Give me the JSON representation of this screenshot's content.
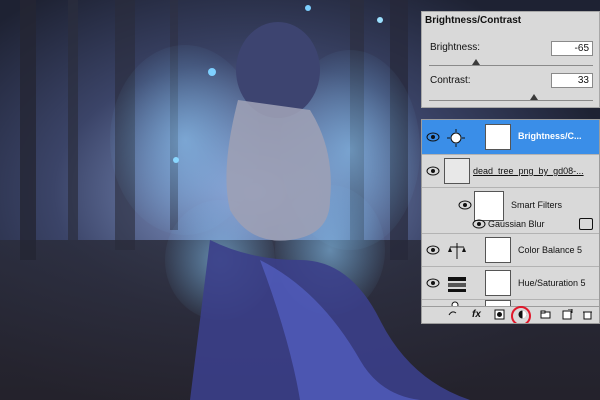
{
  "panel_bc": {
    "title": "Brightness/Contrast",
    "brightness_label": "Brightness:",
    "brightness_value": "-65",
    "contrast_label": "Contrast:",
    "contrast_value": "33"
  },
  "layers": [
    {
      "name": "Brightness/C...",
      "type": "adjustment-brightness",
      "selected": true
    },
    {
      "name": "dead_tree_png_by_gd08-...",
      "type": "smart-object"
    },
    {
      "name": "Smart Filters",
      "type": "smart-filters"
    },
    {
      "name": "Gaussian Blur",
      "type": "filter"
    },
    {
      "name": "Color Balance 5",
      "type": "adjustment-color-balance"
    },
    {
      "name": "Hue/Saturation 5",
      "type": "adjustment-hue-saturation"
    }
  ],
  "colors": {
    "selection": "#3a8ee8",
    "panel_bg": "#d9d9d9",
    "highlight_circle": "#e0182b"
  },
  "footer_icons": [
    "link-icon",
    "fx-icon",
    "mask-icon",
    "adjustment-icon",
    "group-icon",
    "new-layer-icon",
    "trash-icon"
  ]
}
